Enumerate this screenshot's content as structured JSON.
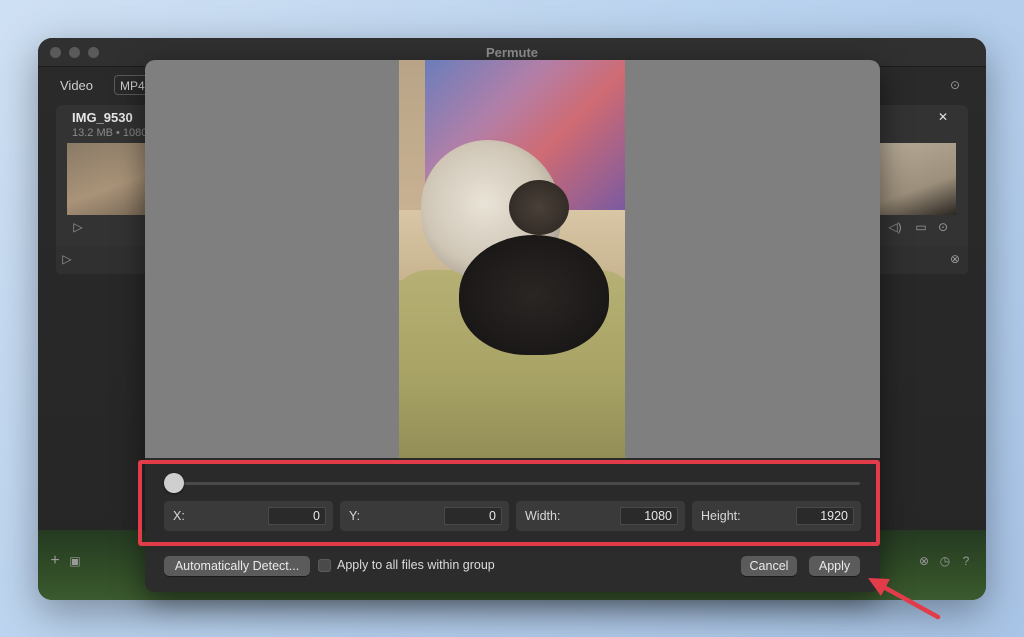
{
  "window": {
    "title": "Permute"
  },
  "background": {
    "toolbar_label": "Video",
    "format_value": "MP4",
    "item": {
      "title": "IMG_9530",
      "meta": "13.2 MB • 1080"
    }
  },
  "crop_panel": {
    "slider_position": 0.0,
    "fields": [
      {
        "label": "X:",
        "value": "0"
      },
      {
        "label": "Y:",
        "value": "0"
      },
      {
        "label": "Width:",
        "value": "1080"
      },
      {
        "label": "Height:",
        "value": "1920"
      }
    ],
    "auto_detect_label": "Automatically Detect...",
    "apply_all_label": "Apply to all files within group",
    "apply_all_checked": false,
    "cancel_label": "Cancel",
    "apply_label": "Apply"
  },
  "colors": {
    "highlight": "#e23b4a",
    "arrow": "#e23b4a"
  },
  "icons": [
    "play-icon",
    "close-icon",
    "plus-icon",
    "gear-icon",
    "clock-icon",
    "help-icon",
    "speaker-icon",
    "share-icon"
  ]
}
